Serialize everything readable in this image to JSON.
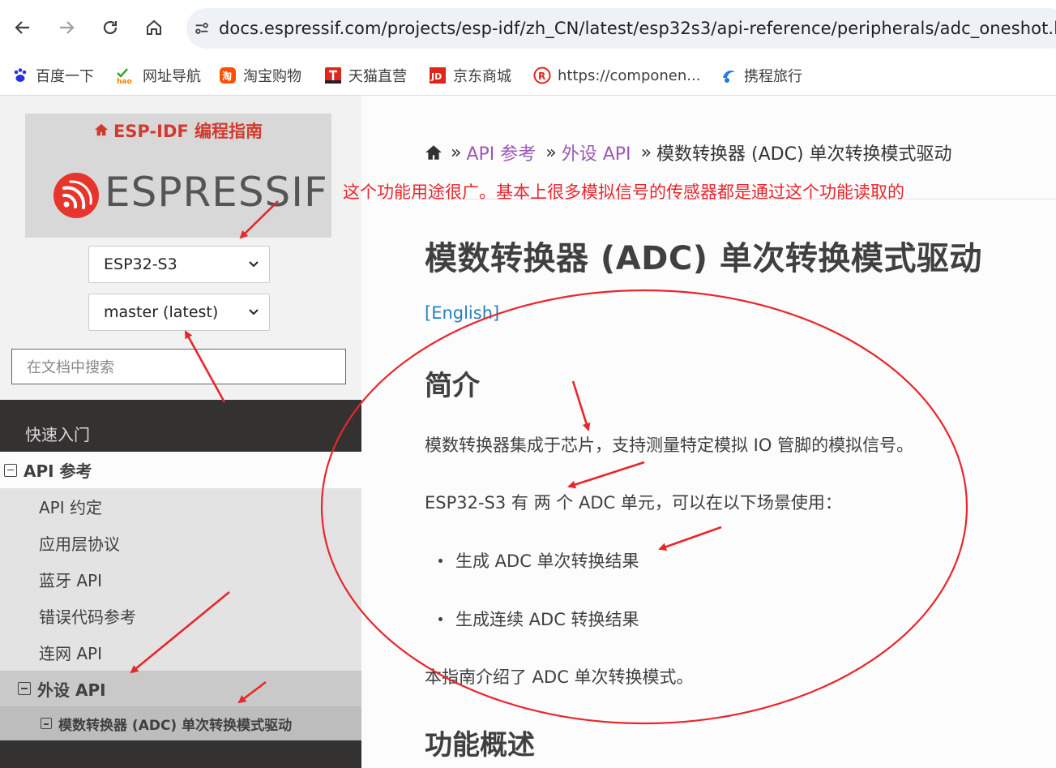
{
  "browser": {
    "url": "docs.espressif.com/projects/esp-idf/zh_CN/latest/esp32s3/api-reference/peripherals/adc_oneshot.html",
    "bookmarks": [
      {
        "label": "百度一下",
        "icon": "baidu-paw-icon",
        "color": "#2932e1"
      },
      {
        "label": "网址导航",
        "icon": "hao123-icon",
        "color": "#3aa335"
      },
      {
        "label": "淘宝购物",
        "icon": "taobao-icon",
        "color": "#ff5000"
      },
      {
        "label": "天猫直营",
        "icon": "tmall-icon",
        "color": "#e1251b"
      },
      {
        "label": "京东商城",
        "icon": "jd-icon",
        "color": "#e1251b"
      },
      {
        "label": "https://componen...",
        "icon": "component-registry-icon",
        "color": "#e1251b"
      },
      {
        "label": "携程旅行",
        "icon": "ctrip-icon",
        "color": "#2577e3"
      }
    ]
  },
  "sidebar": {
    "guide_title": "ESP-IDF 编程指南",
    "logo_text": "ESPRESSIF",
    "target_select": "ESP32-S3",
    "version_select": "master (latest)",
    "search_placeholder": "在文档中搜索",
    "nav": {
      "quick_start": "快速入门",
      "api_reference": "API 参考",
      "api_conventions": "API 约定",
      "app_protocols": "应用层协议",
      "bluetooth": "蓝牙 API",
      "error_codes": "错误代码参考",
      "networking": "连网 API",
      "peripherals": "外设 API",
      "adc_oneshot": "模数转换器 (ADC) 单次转换模式驱动"
    }
  },
  "content": {
    "breadcrumb": {
      "sep": "»",
      "api_ref": "API 参考",
      "peripherals": "外设 API",
      "current": "模数转换器 (ADC) 单次转换模式驱动"
    },
    "title": "模数转换器 (ADC) 单次转换模式驱动",
    "lang_link": "[English]",
    "intro_heading": "简介",
    "intro_p1": "模数转换器集成于芯片，支持测量特定模拟 IO 管脚的模拟信号。",
    "intro_p2": "ESP32-S3 有 两 个 ADC 单元，可以在以下场景使用：",
    "bullets": [
      "生成 ADC 单次转换结果",
      "生成连续 ADC 转换结果"
    ],
    "intro_p3": "本指南介绍了 ADC 单次转换模式。",
    "overview_heading": "功能概述"
  },
  "annotation": {
    "note": "这个功能用途很广。基本上很多模拟信号的传感器都是通过这个功能读取的",
    "color": "#e8262c"
  },
  "colors": {
    "brand_red": "#d13b2f",
    "link_purple": "#9b59b6",
    "link_blue": "#2980b9",
    "nav_dark": "#343131"
  }
}
